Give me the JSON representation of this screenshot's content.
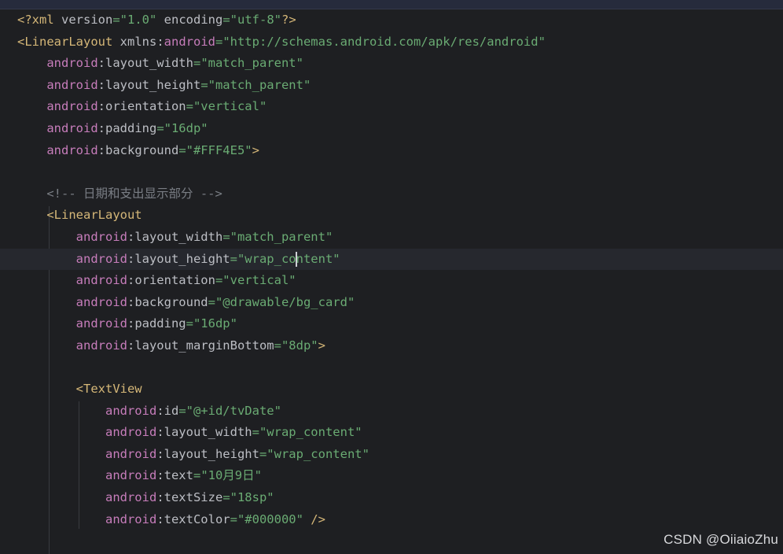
{
  "editor": {
    "current_line": 12,
    "caret": {
      "line": 12,
      "after_text": "\"wrap_co"
    },
    "lines": [
      {
        "tokens": [
          {
            "t": "tag",
            "v": "<?xml "
          },
          {
            "t": "plain",
            "v": "version"
          },
          {
            "t": "val",
            "v": "=\"1.0\""
          },
          {
            "t": "plain",
            "v": " encoding"
          },
          {
            "t": "val",
            "v": "=\"utf-8\""
          },
          {
            "t": "tag",
            "v": "?>"
          }
        ]
      },
      {
        "tokens": [
          {
            "t": "tag",
            "v": "<LinearLayout "
          },
          {
            "t": "plain",
            "v": "xmlns:"
          },
          {
            "t": "ns",
            "v": "android"
          },
          {
            "t": "val",
            "v": "=\"http://schemas.android.com/apk/res/android\""
          }
        ]
      },
      {
        "tokens": [
          {
            "t": "plain",
            "v": "    "
          },
          {
            "t": "ns",
            "v": "android"
          },
          {
            "t": "attr",
            "v": ":layout_width"
          },
          {
            "t": "val",
            "v": "=\"match_parent\""
          }
        ]
      },
      {
        "tokens": [
          {
            "t": "plain",
            "v": "    "
          },
          {
            "t": "ns",
            "v": "android"
          },
          {
            "t": "attr",
            "v": ":layout_height"
          },
          {
            "t": "val",
            "v": "=\"match_parent\""
          }
        ]
      },
      {
        "tokens": [
          {
            "t": "plain",
            "v": "    "
          },
          {
            "t": "ns",
            "v": "android"
          },
          {
            "t": "attr",
            "v": ":orientation"
          },
          {
            "t": "val",
            "v": "=\"vertical\""
          }
        ]
      },
      {
        "tokens": [
          {
            "t": "plain",
            "v": "    "
          },
          {
            "t": "ns",
            "v": "android"
          },
          {
            "t": "attr",
            "v": ":padding"
          },
          {
            "t": "val",
            "v": "=\"16dp\""
          }
        ]
      },
      {
        "tokens": [
          {
            "t": "plain",
            "v": "    "
          },
          {
            "t": "ns",
            "v": "android"
          },
          {
            "t": "attr",
            "v": ":background"
          },
          {
            "t": "val",
            "v": "=\"#FFF4E5\""
          },
          {
            "t": "tag",
            "v": ">"
          }
        ]
      },
      {
        "tokens": []
      },
      {
        "tokens": [
          {
            "t": "plain",
            "v": "    "
          },
          {
            "t": "com",
            "v": "<!-- 日期和支出显示部分 -->"
          }
        ]
      },
      {
        "tokens": [
          {
            "t": "plain",
            "v": "    "
          },
          {
            "t": "tag",
            "v": "<LinearLayout"
          }
        ]
      },
      {
        "tokens": [
          {
            "t": "plain",
            "v": "        "
          },
          {
            "t": "ns",
            "v": "android"
          },
          {
            "t": "attr",
            "v": ":layout_width"
          },
          {
            "t": "val",
            "v": "=\"match_parent\""
          }
        ]
      },
      {
        "tokens": [
          {
            "t": "plain",
            "v": "        "
          },
          {
            "t": "ns",
            "v": "android"
          },
          {
            "t": "attr",
            "v": ":layout_height"
          },
          {
            "t": "val",
            "v": "=\"wrap_co"
          },
          {
            "t": "caret",
            "v": ""
          },
          {
            "t": "val",
            "v": "ntent\""
          }
        ]
      },
      {
        "tokens": [
          {
            "t": "plain",
            "v": "        "
          },
          {
            "t": "ns",
            "v": "android"
          },
          {
            "t": "attr",
            "v": ":orientation"
          },
          {
            "t": "val",
            "v": "=\"vertical\""
          }
        ]
      },
      {
        "tokens": [
          {
            "t": "plain",
            "v": "        "
          },
          {
            "t": "ns",
            "v": "android"
          },
          {
            "t": "attr",
            "v": ":background"
          },
          {
            "t": "val",
            "v": "=\"@drawable/bg_card\""
          }
        ]
      },
      {
        "tokens": [
          {
            "t": "plain",
            "v": "        "
          },
          {
            "t": "ns",
            "v": "android"
          },
          {
            "t": "attr",
            "v": ":padding"
          },
          {
            "t": "val",
            "v": "=\"16dp\""
          }
        ]
      },
      {
        "tokens": [
          {
            "t": "plain",
            "v": "        "
          },
          {
            "t": "ns",
            "v": "android"
          },
          {
            "t": "attr",
            "v": ":layout_marginBottom"
          },
          {
            "t": "val",
            "v": "=\"8dp\""
          },
          {
            "t": "tag",
            "v": ">"
          }
        ]
      },
      {
        "tokens": []
      },
      {
        "tokens": [
          {
            "t": "plain",
            "v": "        "
          },
          {
            "t": "tag",
            "v": "<TextView"
          }
        ]
      },
      {
        "tokens": [
          {
            "t": "plain",
            "v": "            "
          },
          {
            "t": "ns",
            "v": "android"
          },
          {
            "t": "attr",
            "v": ":id"
          },
          {
            "t": "val",
            "v": "=\"@+id/tvDate\""
          }
        ]
      },
      {
        "tokens": [
          {
            "t": "plain",
            "v": "            "
          },
          {
            "t": "ns",
            "v": "android"
          },
          {
            "t": "attr",
            "v": ":layout_width"
          },
          {
            "t": "val",
            "v": "=\"wrap_content\""
          }
        ]
      },
      {
        "tokens": [
          {
            "t": "plain",
            "v": "            "
          },
          {
            "t": "ns",
            "v": "android"
          },
          {
            "t": "attr",
            "v": ":layout_height"
          },
          {
            "t": "val",
            "v": "=\"wrap_content\""
          }
        ]
      },
      {
        "tokens": [
          {
            "t": "plain",
            "v": "            "
          },
          {
            "t": "ns",
            "v": "android"
          },
          {
            "t": "attr",
            "v": ":text"
          },
          {
            "t": "val",
            "v": "=\"10月9日\""
          }
        ]
      },
      {
        "tokens": [
          {
            "t": "plain",
            "v": "            "
          },
          {
            "t": "ns",
            "v": "android"
          },
          {
            "t": "attr",
            "v": ":textSize"
          },
          {
            "t": "val",
            "v": "=\"18sp\""
          }
        ]
      },
      {
        "tokens": [
          {
            "t": "plain",
            "v": "            "
          },
          {
            "t": "ns",
            "v": "android"
          },
          {
            "t": "attr",
            "v": ":textColor"
          },
          {
            "t": "val",
            "v": "=\"#000000\""
          },
          {
            "t": "tag",
            "v": " />"
          }
        ]
      }
    ]
  },
  "watermark": {
    "text": "CSDN @OiiaioZhu"
  },
  "colors": {
    "background": "#1e1f22",
    "tag": "#d5b778",
    "namespace": "#c77dbb",
    "attribute": "#bcbec4",
    "value": "#6aab73",
    "comment": "#7a7e85"
  }
}
